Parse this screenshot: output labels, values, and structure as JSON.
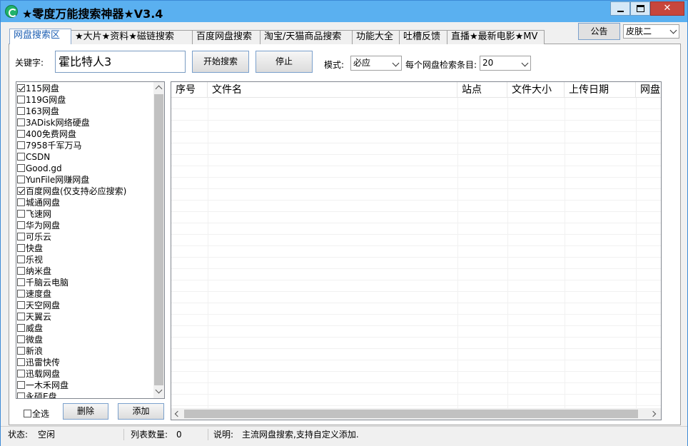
{
  "window": {
    "title": "★零度万能搜索神器★V3.4",
    "icon": "app-logo-icon"
  },
  "tabs": [
    {
      "label": "网盘搜索区",
      "active": true
    },
    {
      "label": "★大片★资料★磁链搜索",
      "active": false
    },
    {
      "label": "百度网盘搜索",
      "active": false
    },
    {
      "label": "淘宝/天猫商品搜索",
      "active": false
    },
    {
      "label": "功能大全",
      "active": false
    },
    {
      "label": "吐槽反馈",
      "active": false
    },
    {
      "label": "直播★最新电影★MV",
      "active": false
    }
  ],
  "top_right": {
    "notice_label": "公告",
    "skin_value": "皮肤二"
  },
  "search": {
    "keyword_label": "关键字:",
    "keyword_value": "霍比特人3",
    "search_button": "开始搜索",
    "stop_button": "停止",
    "mode_label": "模式:",
    "mode_value": "必应",
    "count_label": "每个网盘检索条目:",
    "count_value": "20"
  },
  "disk_list": [
    {
      "label": "115网盘",
      "checked": true
    },
    {
      "label": "119G网盘",
      "checked": false
    },
    {
      "label": "163网盘",
      "checked": false
    },
    {
      "label": "3ADisk网络硬盘",
      "checked": false
    },
    {
      "label": "400免费网盘",
      "checked": false
    },
    {
      "label": "7958千军万马",
      "checked": false
    },
    {
      "label": "CSDN",
      "checked": false
    },
    {
      "label": "Good.gd",
      "checked": false
    },
    {
      "label": "YunFile网赚网盘",
      "checked": false
    },
    {
      "label": "百度网盘(仅支持必应搜索)",
      "checked": true
    },
    {
      "label": "城通网盘",
      "checked": false
    },
    {
      "label": "飞速网",
      "checked": false
    },
    {
      "label": "华为网盘",
      "checked": false
    },
    {
      "label": "可乐云",
      "checked": false
    },
    {
      "label": "快盘",
      "checked": false
    },
    {
      "label": "乐视",
      "checked": false
    },
    {
      "label": "纳米盘",
      "checked": false
    },
    {
      "label": "千脑云电脑",
      "checked": false
    },
    {
      "label": "速度盘",
      "checked": false
    },
    {
      "label": "天空网盘",
      "checked": false
    },
    {
      "label": "天翼云",
      "checked": false
    },
    {
      "label": "威盘",
      "checked": false
    },
    {
      "label": "微盘",
      "checked": false
    },
    {
      "label": "新浪",
      "checked": false
    },
    {
      "label": "迅雷快传",
      "checked": false
    },
    {
      "label": "迅载网盘",
      "checked": false
    },
    {
      "label": "一木禾网盘",
      "checked": false
    },
    {
      "label": "永硕E盘",
      "checked": false
    }
  ],
  "list_controls": {
    "select_all_label": "全选",
    "select_all_checked": false,
    "delete_button": "删除",
    "add_button": "添加"
  },
  "results": {
    "columns": [
      "序号",
      "文件名",
      "站点",
      "文件大小",
      "上传日期",
      "网盘"
    ],
    "rows": []
  },
  "statusbar": {
    "status_label": "状态:",
    "status_value": "空闲",
    "count_label": "列表数量:",
    "count_value": "0",
    "desc_label": "说明:",
    "desc_value": "主流网盘搜索,支持自定义添加."
  }
}
